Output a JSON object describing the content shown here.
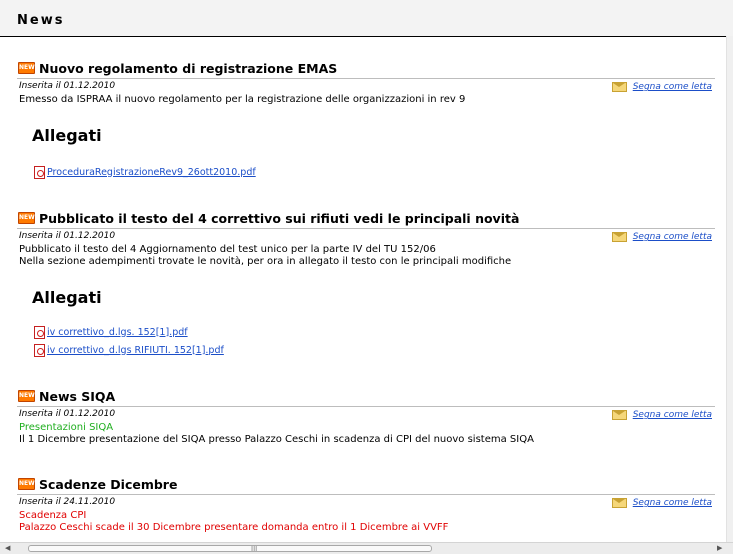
{
  "page": {
    "title": "News"
  },
  "items": [
    {
      "badge": "NEW",
      "title": "Nuovo regolamento di registrazione EMAS",
      "date": "Inserita il 01.12.2010",
      "mark_read": "Segna come letta",
      "body": [
        "Emesso da ISPRAA il nuovo regolamento per la registrazione delle organizzazioni in rev 9"
      ],
      "attachments_heading": "Allegati",
      "attachments": [
        " ProceduraRegistrazioneRev9_26ott2010.pdf"
      ]
    },
    {
      "badge": "NEW",
      "title": "Pubblicato il testo del 4 correttivo sui rifiuti vedi le principali novità",
      "date": "Inserita il 01.12.2010",
      "mark_read": "Segna come letta",
      "body": [
        "Pubblicato il testo del 4 Aggiornamento del test unico per la parte IV del TU 152/06",
        "Nella sezione adempimenti trovate le novità, per ora in allegato il testo con le principali modifiche"
      ],
      "attachments_heading": "Allegati",
      "attachments": [
        " iv correttivo_d.lgs. 152[1].pdf",
        " iv correttivo_d.lgs RIFIUTI. 152[1].pdf"
      ]
    },
    {
      "badge": "NEW",
      "title": "News SIQA",
      "date": "Inserita il 01.12.2010",
      "mark_read": "Segna come letta",
      "highlight": "Presentazioni SIQA",
      "highlight_color": "#1fae1f",
      "body": [
        "Il 1 Dicembre presentazione del SIQA presso Palazzo Ceschi in scadenza di CPI del nuovo sistema SIQA"
      ]
    },
    {
      "badge": "NEW",
      "title": "Scadenze Dicembre",
      "date": "Inserita il 24.11.2010",
      "mark_read": "Segna come letta",
      "highlight": "Scadenza CPI",
      "highlight_color": "#e00000",
      "body": [
        "Palazzo Ceschi scade il 30 Dicembre presentare domanda entro il 1 Dicembre ai VVFF"
      ]
    }
  ],
  "colors": {
    "link": "#1b4ec8",
    "badge": "#ff7a00",
    "header_bg": "#f3f3f3"
  },
  "scrollbar": {
    "left_arrow": "◀",
    "right_arrow": "▶",
    "grip": "III"
  }
}
